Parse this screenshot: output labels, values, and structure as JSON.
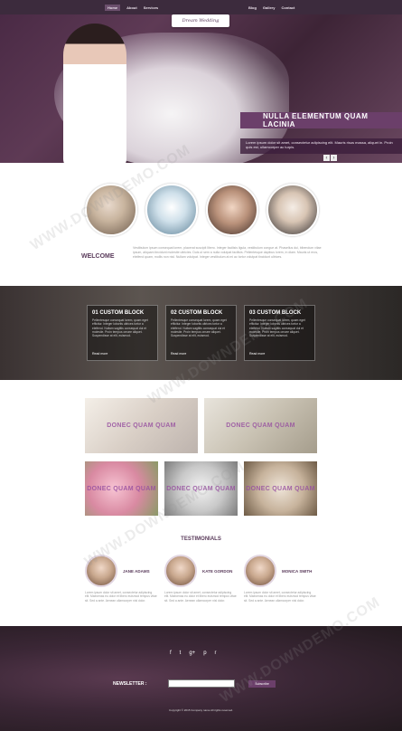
{
  "nav": {
    "left": [
      "Home",
      "About",
      "Services"
    ],
    "right": [
      "Blog",
      "Gallery",
      "Contact"
    ]
  },
  "logo": "Dream Wedding",
  "hero": {
    "caption_title": "NULLA ELEMENTUM QUAM LACINIA",
    "caption_text": "Lorem ipsum dolor sit amet, consectetur adipiscing elit. Mauris risus massa, aliquet in. Proin quis est, ullamcorper ac turpis.",
    "prev_label": "‹",
    "next_label": "›"
  },
  "welcome": {
    "title": "WELCOME",
    "text": "Vestibulum ipsum consequat lorem, placerat suscipit libero. Integer facilisis ligula, vestibulum congue at. Phasellus dui, bibendum vitae ipsum, aliquam tincidunt molestie ultricies. Duis ut sem a nulla volutpat facilisis. Pellentesque dapibus lorem, in diam. Mauris ut eros, eleifend quam, mollis non nisl. Nullam volutpat. Integer vestibulum at mi ac tortor volutpat tincidunt ultrices."
  },
  "blocks": [
    {
      "title": "01 CUSTOM BLOCK",
      "text": "Pellentesque consequat lorem, quam eget efficitur. Integer lobortis ultrices tortor a eleifend. Nullam sagittis consequat dui et molestie. Proin tempus ornare aliquet. Suspendisse at elit, euismod.",
      "link": "Read more"
    },
    {
      "title": "02 CUSTOM BLOCK",
      "text": "Pellentesque consequat lorem, quam eget efficitur. Integer lobortis ultrices tortor a eleifend. Nullam sagittis consequat dui et molestie. Proin tempus ornare aliquet. Suspendisse at elit, euismod.",
      "link": "Read more"
    },
    {
      "title": "03 CUSTOM BLOCK",
      "text": "Pellentesque consequat lorem, quam eget efficitur. Integer lobortis ultrices tortor a eleifend. Nullam sagittis consequat dui et molestie. Proin tempus ornare aliquet. Suspendisse at elit, euismod.",
      "link": "Read more"
    }
  ],
  "gallery": {
    "top": [
      "DONEC QUAM QUAM",
      "DONEC QUAM QUAM"
    ],
    "bottom": [
      "DONEC QUAM QUAM",
      "DONEC QUAM QUAM",
      "DONEC QUAM QUAM"
    ]
  },
  "testimonials": {
    "title": "TESTIMONIALS",
    "people": [
      {
        "name": "JANE ADAMS",
        "text": "Lorem ipsum dolor sit amet, consectetur adipiscing elit. Maecenas eu dolor et libero euismod tempus vitae sit. Sed a ante. Aenean ullamcorper nisl dolor."
      },
      {
        "name": "KATE GORDON",
        "text": "Lorem ipsum dolor sit amet, consectetur adipiscing elit. Maecenas eu dolor et libero euismod tempus vitae sit. Sed a ante. Aenean ullamcorper nisl dolor."
      },
      {
        "name": "MONICA SMITH",
        "text": "Lorem ipsum dolor sit amet, consectetur adipiscing elit. Maecenas eu dolor et libero euismod tempus vitae sit. Sed a ante. Aenean ullamcorper nisl dolor."
      }
    ]
  },
  "footer": {
    "social": [
      "f",
      "t",
      "g+",
      "p",
      "r"
    ],
    "newsletter_label": "NEWSLETTER :",
    "subscribe_label": "Subscribe",
    "copyright": "Copyright © 2015 Company name All rights reserved."
  },
  "watermarks": [
    "WWW.DOWNDEMO.COM",
    "WWW.DOWNDEMO.COM",
    "WWW.DOWNDEMO.COM",
    "WWW.DOWNDEMO.COM"
  ],
  "colors": {
    "accent": "#6b3f6a",
    "heading": "#5a3b5b",
    "nav_bg": "#3c2b3d"
  }
}
